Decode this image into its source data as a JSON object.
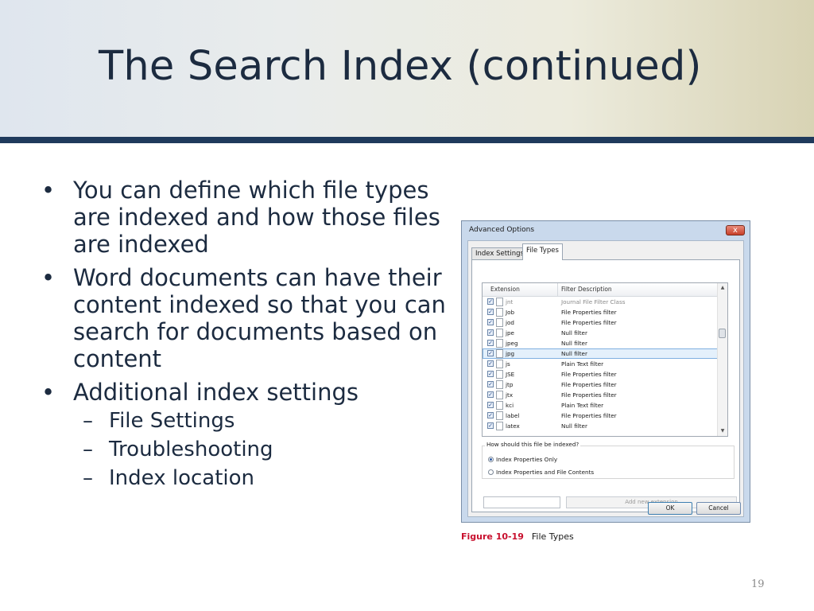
{
  "slide": {
    "title": "The Search Index (continued)",
    "page_number": "19"
  },
  "bullets": [
    {
      "text": "You can define which file types are indexed and how those files are indexed"
    },
    {
      "text": "Word documents can have their content indexed so that you can search for documents based on content"
    },
    {
      "text": "Additional index settings",
      "sub": [
        "File Settings",
        "Troubleshooting",
        "Index location"
      ]
    }
  ],
  "dialog": {
    "title": "Advanced Options",
    "close_label": "x",
    "tabs": [
      "Index Settings",
      "File Types"
    ],
    "active_tab": "File Types",
    "columns": [
      "Extension",
      "Filter Description"
    ],
    "rows": [
      {
        "ext": "jnt",
        "filter": "Journal File Filter Class",
        "checked": true
      },
      {
        "ext": "Job",
        "filter": "File Properties filter",
        "checked": true
      },
      {
        "ext": "jod",
        "filter": "File Properties filter",
        "checked": true
      },
      {
        "ext": "jpe",
        "filter": "Null filter",
        "checked": true
      },
      {
        "ext": "jpeg",
        "filter": "Null filter",
        "checked": true
      },
      {
        "ext": "jpg",
        "filter": "Null filter",
        "checked": true,
        "selected": true
      },
      {
        "ext": "js",
        "filter": "Plain Text filter",
        "checked": true
      },
      {
        "ext": "JSE",
        "filter": "File Properties filter",
        "checked": true
      },
      {
        "ext": "jtp",
        "filter": "File Properties filter",
        "checked": true
      },
      {
        "ext": "jtx",
        "filter": "File Properties filter",
        "checked": true
      },
      {
        "ext": "kci",
        "filter": "Plain Text filter",
        "checked": true
      },
      {
        "ext": "label",
        "filter": "File Properties filter",
        "checked": true
      },
      {
        "ext": "latex",
        "filter": "Null filter",
        "checked": true
      }
    ],
    "index_question": "How should this file be indexed?",
    "options": [
      "Index Properties Only",
      "Index Properties and File Contents"
    ],
    "selected_option": 0,
    "add_extension_label": "Add new extension",
    "ok_label": "OK",
    "cancel_label": "Cancel"
  },
  "caption": {
    "figure": "Figure 10-19",
    "text": "File Types"
  },
  "colors": {
    "title": "#1c2b40",
    "header_bar": "#1f3a5c",
    "figure_label": "#c8102e"
  }
}
